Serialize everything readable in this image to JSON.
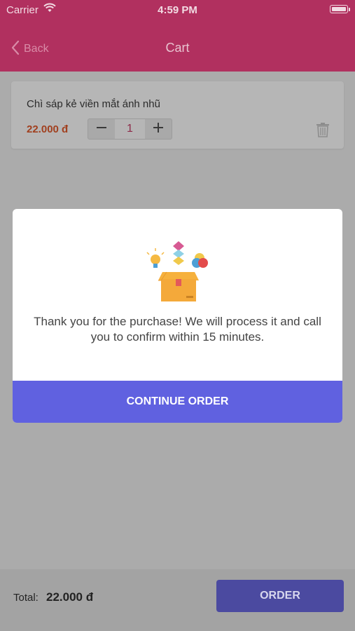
{
  "status_bar": {
    "carrier": "Carrier",
    "time": "4:59 PM"
  },
  "nav": {
    "back_label": "Back",
    "title": "Cart"
  },
  "cart": {
    "items": [
      {
        "name": "Chì sáp kẻ viền mắt ánh nhũ",
        "price": "22.000 đ",
        "quantity": "1"
      }
    ]
  },
  "modal": {
    "message": "Thank you for the purchase! We will process it and call you to confirm within 15 minutes.",
    "continue_label": "CONTINUE ORDER"
  },
  "footer": {
    "total_label": "Total:",
    "total_value": "22.000 đ",
    "order_label": "ORDER"
  },
  "colors": {
    "header": "#b1305f",
    "accent": "#6061e0",
    "price": "#a1401f"
  },
  "icons": [
    "wifi-icon",
    "battery-icon",
    "chevron-left-icon",
    "minus-icon",
    "plus-icon",
    "trash-icon",
    "gift-box-illustration"
  ]
}
